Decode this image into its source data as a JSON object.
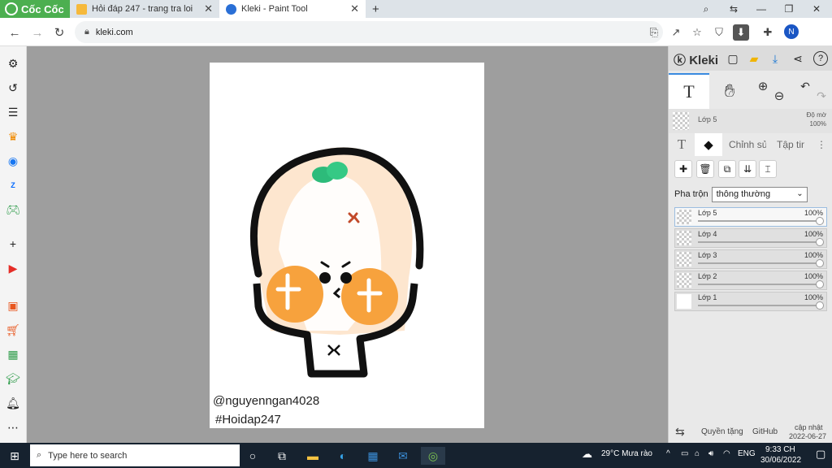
{
  "browser": {
    "brand": "Cốc Cốc",
    "tabs": [
      {
        "title": "Hỏi đáp 247 - trang tra loi",
        "active": false
      },
      {
        "title": "Kleki - Paint Tool",
        "active": true
      }
    ],
    "new_tab": "+",
    "url": "kleki.com",
    "profile_initial": "N"
  },
  "canvas": {
    "watermark_line1": "@nguyenngan4028",
    "watermark_line2": "#Hoidap247"
  },
  "kleki": {
    "logo": "Kleki",
    "layer_preview_name": "Lớp 5",
    "opacity_label": "Độ mờ",
    "opacity_value": "100%",
    "tool_text": "T",
    "tabs": {
      "edit": "Chỉnh sửa",
      "file": "Tập tin"
    },
    "blend_label": "Pha trộn",
    "blend_value": "thông thường",
    "layers": [
      {
        "name": "Lớp 5",
        "opacity": "100%",
        "selected": true
      },
      {
        "name": "Lớp 4",
        "opacity": "100%",
        "selected": false
      },
      {
        "name": "Lớp 3",
        "opacity": "100%",
        "selected": false
      },
      {
        "name": "Lớp 2",
        "opacity": "100%",
        "selected": false
      },
      {
        "name": "Lớp 1",
        "opacity": "100%",
        "selected": false
      }
    ],
    "footer": {
      "privacy": "Quyền tặng",
      "github": "GitHub",
      "update_label": "cập nhật",
      "update_date": "2022-06-27"
    }
  },
  "taskbar": {
    "search_placeholder": "Type here to search",
    "weather": "29°C  Mưa rào",
    "lang": "ENG",
    "time": "9:33 CH",
    "date": "30/06/2022"
  },
  "colors": {
    "brand_green": "#4caf50",
    "taskbar": "#16222f",
    "canvas_bg": "#9e9e9e",
    "accent_blue": "#3a8be0"
  }
}
